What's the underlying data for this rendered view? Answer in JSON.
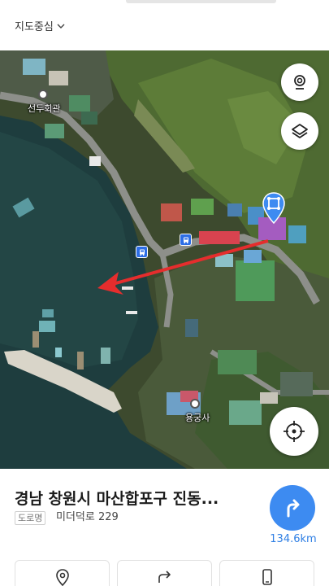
{
  "header": {
    "center_select_label": "지도중심"
  },
  "map": {
    "labels": {
      "seondu_hall": "선두회관",
      "yonggungsa": "용궁사"
    },
    "icons": {
      "layers_toggle": "satellite-view-icon",
      "layers": "layers-icon",
      "my_location": "crosshair-icon",
      "destination": "destination-pin-icon",
      "bus_stop": "bus-stop-icon",
      "temple": "temple-icon"
    },
    "colors": {
      "pin": "#3d8bf1",
      "arrow": "#e52d2d"
    }
  },
  "place": {
    "title": "경남 창원시 마산합포구 진동...",
    "road_badge": "도로명",
    "address": "미더덕로 229",
    "distance": "134.6km"
  },
  "actions": [
    {
      "icon": "location-pin-icon"
    },
    {
      "icon": "share-icon"
    },
    {
      "icon": "phone-icon"
    }
  ],
  "colors": {
    "accent": "#3d8bf1",
    "distance_text": "#2f7fe4"
  }
}
